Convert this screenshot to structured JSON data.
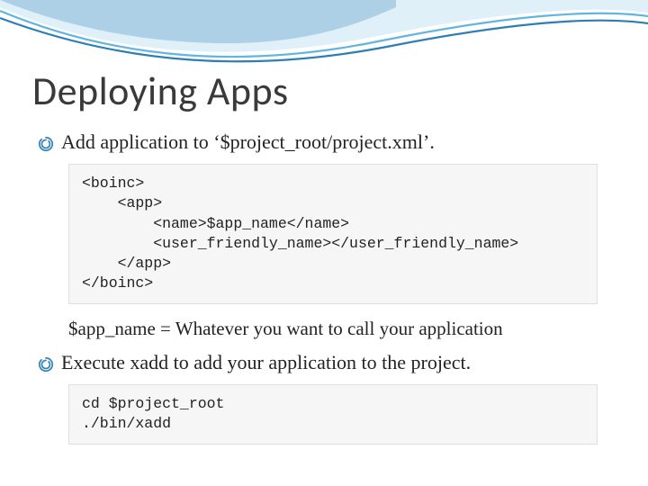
{
  "title": "Deploying Apps",
  "bullets": [
    "Add application to ‘$project_root/project.xml’.",
    "Execute xadd to add your application to the project."
  ],
  "code1": "<boinc>\n    <app>\n        <name>$app_name</name>\n        <user_friendly_name></user_friendly_name>\n    </app>\n</boinc>",
  "note": "$app_name = Whatever you want to call your application",
  "code2": "cd $project_root\n./bin/xadd"
}
